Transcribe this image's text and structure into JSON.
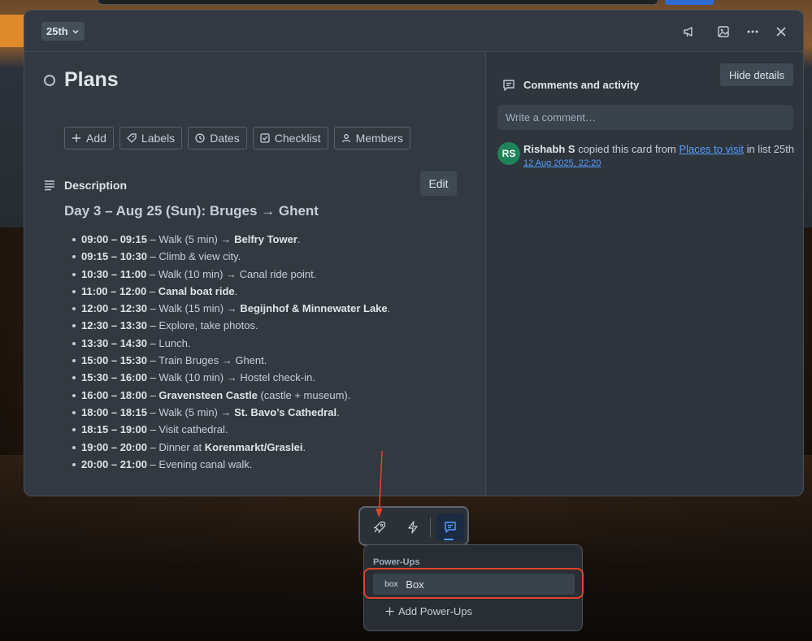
{
  "header": {
    "list_name": "25th",
    "icons": [
      "megaphone-icon",
      "image-icon",
      "more-icon",
      "close-icon"
    ]
  },
  "card": {
    "title": "Plans",
    "actions": [
      {
        "icon": "plus-icon",
        "label": "Add"
      },
      {
        "icon": "tag-icon",
        "label": "Labels"
      },
      {
        "icon": "clock-icon",
        "label": "Dates"
      },
      {
        "icon": "checklist-icon",
        "label": "Checklist"
      },
      {
        "icon": "user-icon",
        "label": "Members"
      }
    ],
    "description": {
      "label": "Description",
      "edit_label": "Edit",
      "heading": "Day 3 – Aug 25 (Sun): Bruges → Ghent",
      "items": [
        {
          "time": "09:00 – 09:15",
          "sep": " – ",
          "text": "Walk (5 min) → ",
          "bold": "Belfry Tower",
          "tail": "."
        },
        {
          "time": "09:15 – 10:30",
          "sep": " – ",
          "text": "Climb & view city.",
          "bold": "",
          "tail": ""
        },
        {
          "time": "10:30 – 11:00",
          "sep": " – ",
          "text": "Walk (10 min) → Canal ride point.",
          "bold": "",
          "tail": ""
        },
        {
          "time": "11:00 – 12:00",
          "sep": " – ",
          "text": "",
          "bold": "Canal boat ride",
          "tail": "."
        },
        {
          "time": "12:00 – 12:30",
          "sep": " – ",
          "text": "Walk (15 min) → ",
          "bold": "Begijnhof & Minnewater Lake",
          "tail": "."
        },
        {
          "time": "12:30 – 13:30",
          "sep": " – ",
          "text": "Explore, take photos.",
          "bold": "",
          "tail": ""
        },
        {
          "time": "13:30 – 14:30",
          "sep": " – ",
          "text": "Lunch.",
          "bold": "",
          "tail": ""
        },
        {
          "time": "15:00 – 15:30",
          "sep": " – ",
          "text": "Train Bruges → Ghent.",
          "bold": "",
          "tail": ""
        },
        {
          "time": "15:30 – 16:00",
          "sep": " – ",
          "text": "Walk (10 min) → Hostel check-in.",
          "bold": "",
          "tail": ""
        },
        {
          "time": "16:00 – 18:00",
          "sep": " – ",
          "text": "",
          "bold": "Gravensteen Castle",
          "tail": " (castle + museum)."
        },
        {
          "time": "18:00 – 18:15",
          "sep": " – ",
          "text": "Walk (5 min) → ",
          "bold": "St. Bavo’s Cathedral",
          "tail": "."
        },
        {
          "time": "18:15 – 19:00",
          "sep": " – ",
          "text": "Visit cathedral.",
          "bold": "",
          "tail": ""
        },
        {
          "time": "19:00 – 20:00",
          "sep": " – ",
          "text": "Dinner at ",
          "bold": "Korenmarkt/Graslei",
          "tail": "."
        },
        {
          "time": "20:00 – 21:00",
          "sep": " – ",
          "text": "Evening canal walk.",
          "bold": "",
          "tail": ""
        }
      ]
    }
  },
  "activity": {
    "title": "Comments and activity",
    "hide_label": "Hide details",
    "comment_placeholder": "Write a comment…",
    "entry": {
      "initials": "RS",
      "user": "Rishabh S",
      "action": " copied this card from ",
      "link": "Places to visit",
      "suffix": " in list 25th",
      "time": "12 Aug 2025, 22:20"
    }
  },
  "toolbar": {
    "buttons": [
      "rocket-icon",
      "lightning-icon",
      "comment-icon"
    ],
    "active": "comment-icon"
  },
  "powerups": {
    "heading": "Power-Ups",
    "item_logo": "box",
    "item_label": "Box",
    "add_label": "Add Power-Ups"
  },
  "colors": {
    "modal_bg": "#323940",
    "accent": "#579dff",
    "avatar": "#1f845a",
    "highlight": "#e0432c"
  }
}
